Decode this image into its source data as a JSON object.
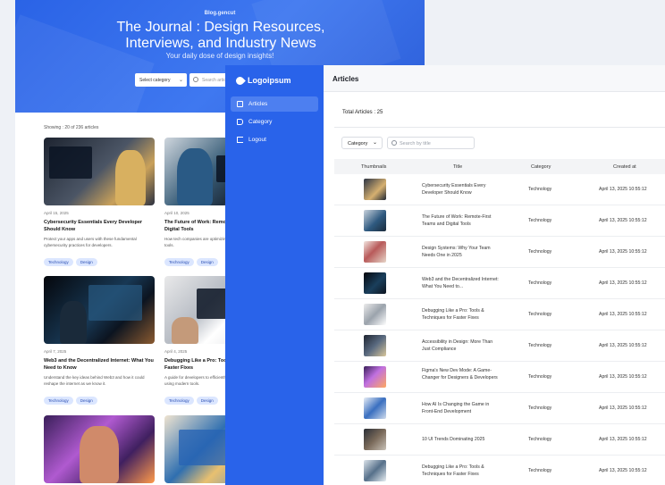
{
  "blog": {
    "eyebrow": "Blog.gencut",
    "title": "The Journal : Design Resources, Interviews, and Industry News",
    "subtitle": "Your daily dose of design insights!",
    "select_label": "Select category",
    "search_placeholder": "Search articles",
    "showing": "Showing : 20 of 236 articles",
    "cards": [
      {
        "date": "April 15, 2025",
        "title": "Cybersecurity Essentials Every Developer Should Know",
        "desc": "Protect your apps and users with these fundamental cybersecurity practices for developers.",
        "tags": [
          "Technology",
          "Design"
        ]
      },
      {
        "date": "April 10, 2025",
        "title": "The Future of Work: Remote-First Teams and Digital Tools",
        "desc": "How tech companies are optimizing collaboration with smarter tools.",
        "tags": [
          "Technology",
          "Design"
        ]
      },
      {
        "date": "April 7, 2025",
        "title": "Web3 and the Decentralized Internet: What You Need to Know",
        "desc": "Understand the key ideas behind Web3 and how it could reshape the internet as we know it.",
        "tags": [
          "Technology",
          "Design"
        ]
      },
      {
        "date": "April 4, 2025",
        "title": "Debugging Like a Pro: Tools & Techniques for Faster Fixes",
        "desc": "A guide for developers to efficiently find and fix code issues using modern tools.",
        "tags": [
          "Technology",
          "Design"
        ]
      },
      {
        "date": "",
        "title": "",
        "desc": "",
        "tags": []
      },
      {
        "date": "",
        "title": "",
        "desc": "",
        "tags": []
      }
    ]
  },
  "sidebar": {
    "logo": "Logoipsum",
    "items": [
      {
        "label": "Articles",
        "icon": "document-icon",
        "active": true
      },
      {
        "label": "Category",
        "icon": "tag-icon",
        "active": false
      },
      {
        "label": "Logout",
        "icon": "logout-icon",
        "active": false
      }
    ]
  },
  "main": {
    "title": "Articles",
    "total": "Total Articles : 25",
    "filter_label": "Category",
    "search_placeholder": "Search by title",
    "columns": [
      "Thumbnails",
      "Title",
      "Category",
      "Created at"
    ],
    "rows": [
      {
        "title": "Cybersecurity Essentials Every Developer Should Know",
        "category": "Technology",
        "created": "April 13, 2025 10:55:12"
      },
      {
        "title": "The Future of Work: Remote-First Teams and Digital Tools",
        "category": "Technology",
        "created": "April 13, 2025 10:55:12"
      },
      {
        "title": "Design Systems: Why Your Team Needs One in 2025",
        "category": "Technology",
        "created": "April 13, 2025 10:55:12"
      },
      {
        "title": "Web3 and the Decentralized Internet: What You Need to...",
        "category": "Technology",
        "created": "April 13, 2025 10:55:12"
      },
      {
        "title": "Debugging Like a Pro: Tools & Techniques for Faster Fixes",
        "category": "Technology",
        "created": "April 13, 2025 10:55:12"
      },
      {
        "title": "Accessibility in Design: More Than Just Compliance",
        "category": "Technology",
        "created": "April 13, 2025 10:55:12"
      },
      {
        "title": "Figma's New Dev Mode: A Game-Changer for Designers & Developers",
        "category": "Technology",
        "created": "April 13, 2025 10:55:12"
      },
      {
        "title": "How AI Is Changing the Game in Front-End Development",
        "category": "Technology",
        "created": "April 13, 2025 10:55:12"
      },
      {
        "title": "10 UI Trends Dominating 2025",
        "category": "Technology",
        "created": "April 13, 2025 10:55:12"
      },
      {
        "title": "Debugging Like a Pro: Tools & Techniques for Faster Fixes",
        "category": "Technology",
        "created": "April 13, 2025 10:55:12"
      }
    ]
  },
  "colors": {
    "brand_blue": "#2963ea",
    "active_nav": "#4d7ff0",
    "tag_bg": "#dbe6ff"
  }
}
